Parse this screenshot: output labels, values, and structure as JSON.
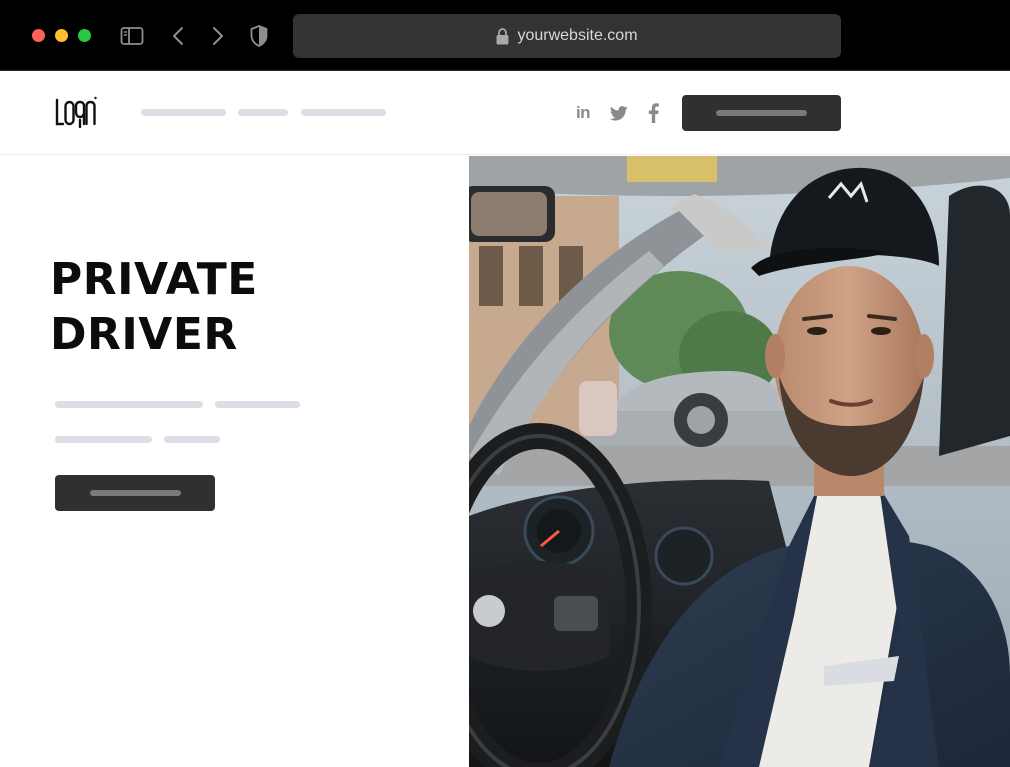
{
  "browser": {
    "url": "yourwebsite.com",
    "traffic_lights": {
      "close": "#ff5f57",
      "minimize": "#febc2e",
      "maximize": "#28c840"
    },
    "icons": [
      "sidebar-icon",
      "back-icon",
      "forward-icon",
      "shield-icon",
      "lock-icon"
    ]
  },
  "header": {
    "logo": "logo",
    "social_icons": [
      "linkedin-icon",
      "twitter-icon",
      "facebook-icon"
    ],
    "linkedin_label": "in"
  },
  "hero": {
    "title_line1": "PRIVATE",
    "title_line2": "DRIVER"
  },
  "colors": {
    "dark_button": "#303030",
    "placeholder_line": "#dedde6",
    "title_text": "#0c0c0c"
  },
  "image": {
    "subject": "driver-photo"
  }
}
